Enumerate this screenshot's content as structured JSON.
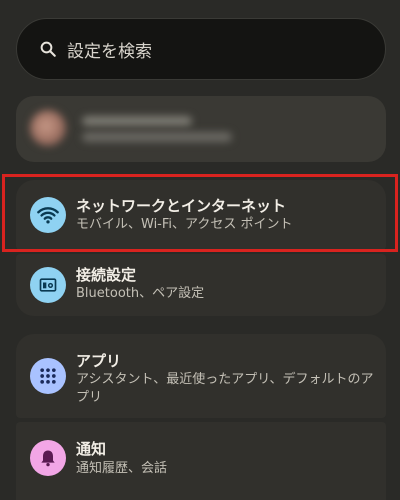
{
  "search": {
    "placeholder": "設定を検索",
    "icon": "search-icon"
  },
  "account": {
    "blurred": true
  },
  "settings": {
    "network": {
      "title": "ネットワークとインターネット",
      "subtitle": "モバイル、Wi-Fi、アクセス ポイント",
      "icon": "wifi-icon",
      "icon_color": "#8fd2f2",
      "highlighted": true,
      "highlight_color": "#d9231f"
    },
    "connection": {
      "title": "接続設定",
      "subtitle": "Bluetooth、ペア設定",
      "icon": "connected-devices-icon",
      "icon_color": "#8fd2f2"
    },
    "apps": {
      "title": "アプリ",
      "subtitle": "アシスタント、最近使ったアプリ、デフォルトのアプリ",
      "icon": "apps-grid-icon",
      "icon_color": "#a9c2ff"
    },
    "notifications": {
      "title": "通知",
      "subtitle": "通知履歴、会話",
      "icon": "bell-icon",
      "icon_color": "#f2a6e6"
    }
  }
}
